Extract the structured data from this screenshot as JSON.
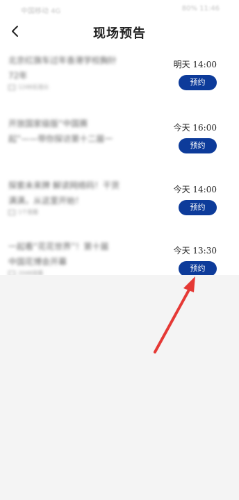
{
  "status_bar": {
    "left": "中国移动 4G",
    "right": "80% 11:46"
  },
  "header": {
    "back_icon": "chevron-left-icon",
    "title": "现场预告"
  },
  "items": [
    {
      "title_line1": "北京红旗车过年香港学校胸针",
      "title_line2": "72年",
      "meta": "1248名观众",
      "time": "明天 14:00",
      "button": "预约"
    },
    {
      "title_line1": "开放国家级版“中国赛",
      "title_line2": "起”——带你探访第十二届一",
      "meta": "",
      "time": "今天 16:00",
      "button": "预约"
    },
    {
      "title_line1": "探索未来牌 解读网络码！干货",
      "title_line2": "满满，从这里开始！",
      "meta": "1个观看",
      "time": "今天 14:00",
      "button": "预约"
    },
    {
      "title_line1": "一起看“花花世界”！第十届",
      "title_line2": "中国花博会开幕",
      "meta": "2048观看",
      "time": "今天 13:30",
      "button": "预约"
    }
  ],
  "colors": {
    "accent": "#0d3b9a",
    "annotation_arrow": "#e53935",
    "background_lower": "#f4f4f4"
  }
}
